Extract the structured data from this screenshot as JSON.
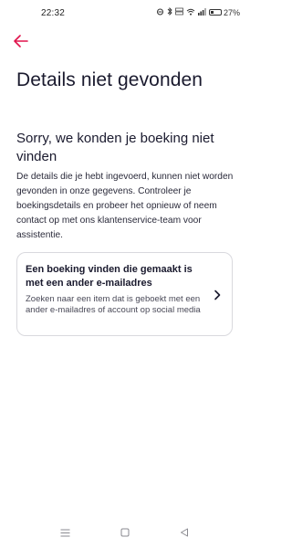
{
  "status_bar": {
    "time": "22:32",
    "battery": "27%"
  },
  "page": {
    "title": "Details niet gevonden",
    "heading": "Sorry, we konden je boeking niet vinden",
    "body": "De details die je hebt ingevoerd, kunnen niet worden gevonden in onze gegevens. Controleer je boekingsdetails en probeer het opnieuw of neem contact op met ons klantenservice-team voor assistentie."
  },
  "card": {
    "title": "Een boeking vinden die gemaakt is met een ander e-mailadres",
    "description": "Zoeken naar een item dat is geboekt met een ander e-mailadres of account op social media"
  },
  "colors": {
    "accent": "#e0144c",
    "text": "#1a1a2e",
    "border": "#d9d9de"
  },
  "icons": {
    "back": "arrow-left-icon",
    "card_action": "chevron-right-icon",
    "nav_menu": "menu-icon",
    "nav_home": "square-home-icon",
    "nav_back": "triangle-back-icon"
  }
}
